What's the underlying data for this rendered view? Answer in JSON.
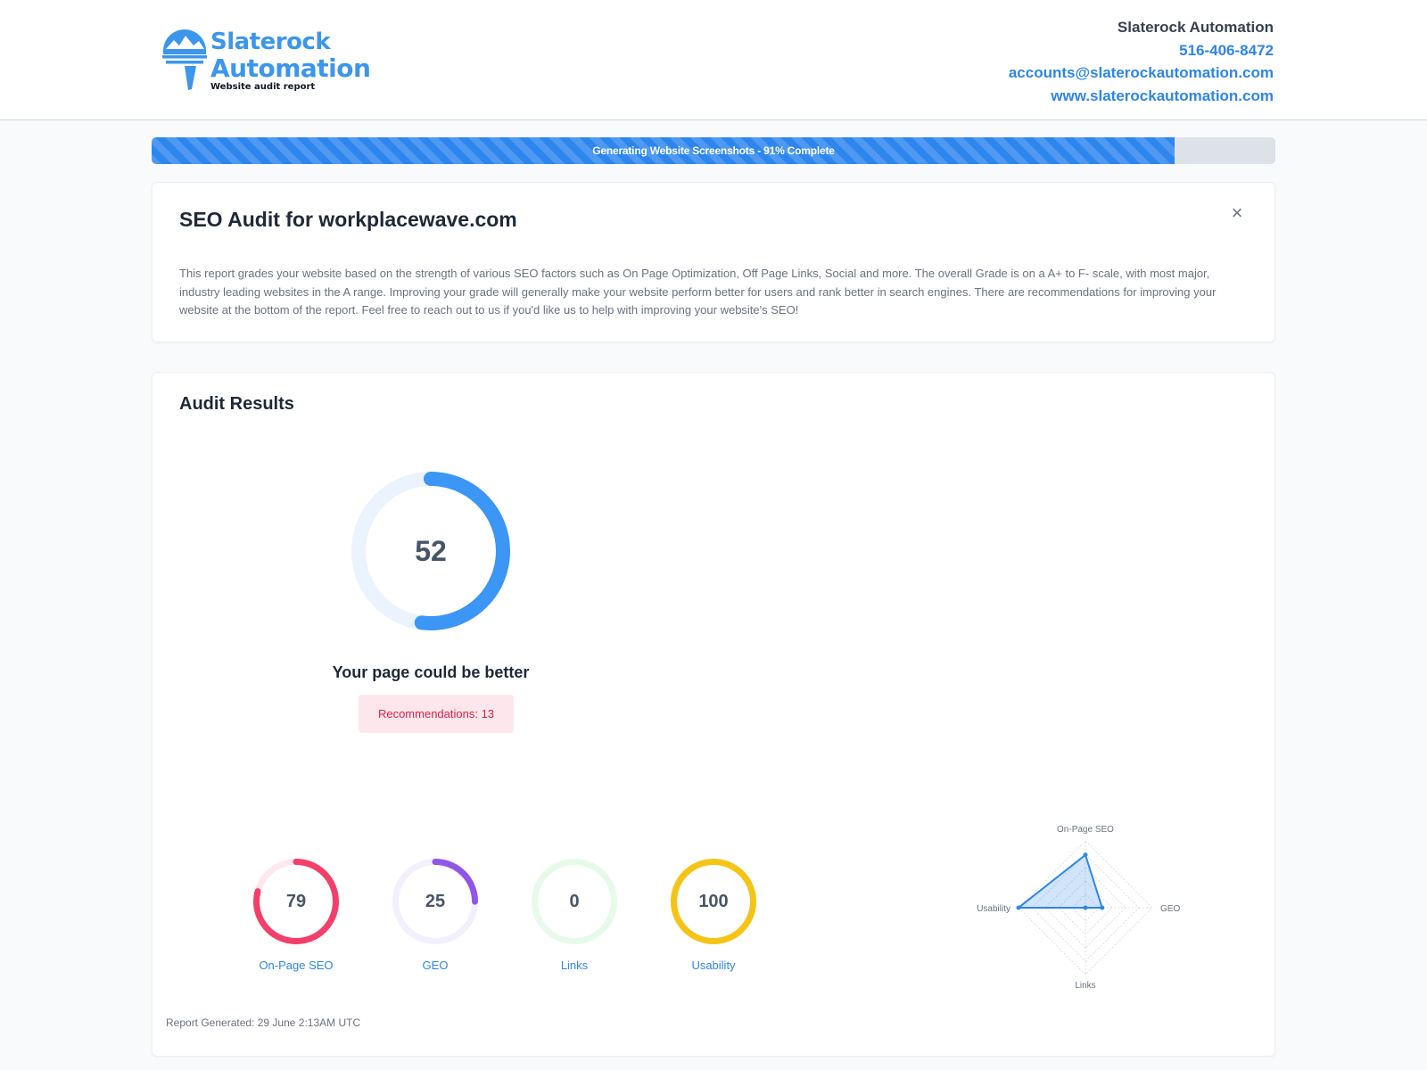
{
  "header": {
    "logo_line1": "Slaterock",
    "logo_line2": "Automation",
    "logo_sub": "Website audit report",
    "contact": {
      "company": "Slaterock Automation",
      "phone": "516-406-8472",
      "email": "accounts@slaterockautomation.com",
      "website": "www.slaterockautomation.com"
    }
  },
  "progress": {
    "label": "Generating Website Screenshots - 91% Complete",
    "percent": 91
  },
  "intro": {
    "title": "SEO Audit for workplacewave.com",
    "close": "×",
    "text": "This report grades your website based on the strength of various SEO factors such as On Page Optimization, Off Page Links, Social and more. The overall Grade is on a A+ to F- scale, with most major, industry leading websites in the A range. Improving your grade will generally make your website perform better for users and rank better in search engines. There are recommendations for improving your website at the bottom of the report. Feel free to reach out to us if you'd like us to help with improving your website's SEO!"
  },
  "results": {
    "title": "Audit Results",
    "overall": {
      "score": 52,
      "caption": "Your page could be better",
      "color": "#3b96f5",
      "track": "#eaf3fe"
    },
    "recommendations": "Recommendations: 13",
    "subscores": [
      {
        "label": "On-Page SEO",
        "score": 79,
        "color": "#f43f6a",
        "track": "#fde8ee"
      },
      {
        "label": "GEO",
        "score": 25,
        "color": "#9155e8",
        "track": "#f3effd"
      },
      {
        "label": "Links",
        "score": 0,
        "color": "#22c55e",
        "track": "#e6faea"
      },
      {
        "label": "Usability",
        "score": 100,
        "color": "#f6c417",
        "track": "#fdf3cc"
      }
    ],
    "radar": {
      "axes": [
        "On-Page SEO",
        "GEO",
        "Links",
        "Usability"
      ],
      "values": [
        79,
        25,
        0,
        100
      ],
      "color": "#2d86e8"
    },
    "footnote": "Report Generated: 29 June 2:13AM UTC"
  }
}
